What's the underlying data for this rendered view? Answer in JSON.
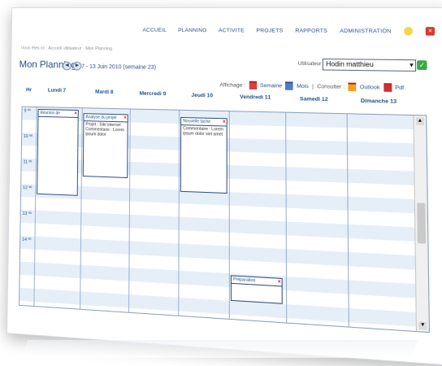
{
  "nav": {
    "items": [
      "ACCUEIL",
      "PLANNING",
      "ACTIVITE",
      "PROJETS",
      "RAPPORTS",
      "ADMINISTRATION"
    ]
  },
  "breadcrumb": "Vous êtes ici : Accueil utilisateur · Mon Planning",
  "page": {
    "title": "Mon Planning",
    "range": "7 - 13 Juin 2010 (semaine 23)"
  },
  "user": {
    "label": "Utilisateur",
    "value": "Hodin matthieu"
  },
  "toolbar": {
    "affichage": "Affichage :",
    "semaine": "Semaine",
    "mois": "Mois",
    "separator": "|",
    "consulter": "Consulter :",
    "outlook": "Outlook",
    "pdf": "Pdf"
  },
  "calendar": {
    "hour_col_label": "Hr",
    "days": [
      "Lundi 7",
      "Mardi 8",
      "Mercredi 9",
      "Jeudi 10",
      "Vendredi 11",
      "Samedi 12",
      "Dimanche 13"
    ],
    "hours": [
      "9 ºº",
      "10 ºº",
      "11 ºº",
      "12 ºº",
      "13 ºº",
      "14 ºº"
    ],
    "events": [
      {
        "title": "Réunion de",
        "body": ""
      },
      {
        "title": "Analyse du projet",
        "body": "Projet : Site internet Commentaire : Lorem ipsum dolor"
      },
      {
        "title": "Nouvelle tache",
        "body": "Commentaire : Lorem ipsum dolor siet amet"
      },
      {
        "title": "Préparation",
        "body": ""
      }
    ]
  },
  "icons": {
    "help": "help-icon",
    "close": "close-icon",
    "prev": "prev-week-icon",
    "next": "next-week-icon"
  }
}
